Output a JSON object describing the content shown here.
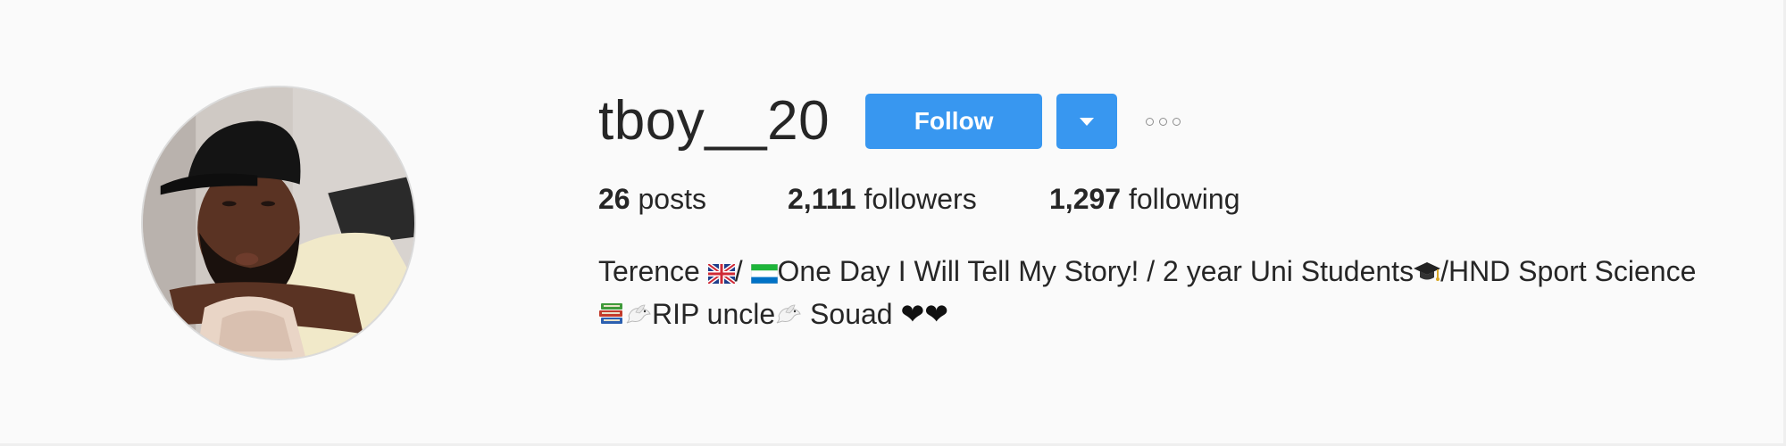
{
  "profile": {
    "username": "tboy__20",
    "follow_label": "Follow",
    "dropdown_icon": "caret-down-icon",
    "more_icon": "more-options-icon",
    "avatar_alt": "profile photo",
    "accent_color": "#3897f0"
  },
  "stats": {
    "posts_count": "26",
    "posts_label": " posts",
    "followers_count": "2,111",
    "followers_label": " followers",
    "following_count": "1,297",
    "following_label": " following"
  },
  "bio": {
    "part1": "Terence ",
    "part2": "/ ",
    "part3": "One Day I Will Tell My Story! / 2 year Uni Students",
    "part4": "/HND Sport Science ",
    "part5": "RIP uncle",
    "part6": " Souad ",
    "hearts": "❤❤"
  }
}
